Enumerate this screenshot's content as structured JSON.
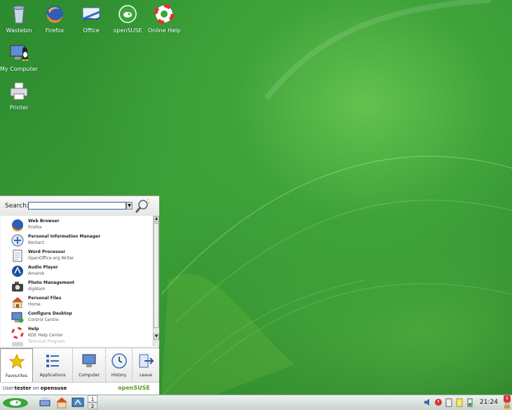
{
  "desktop": {
    "icons": [
      {
        "label": "Wastebin",
        "icon": "wastebin-icon"
      },
      {
        "label": "Firefox",
        "icon": "firefox-icon"
      },
      {
        "label": "Office",
        "icon": "office-icon"
      },
      {
        "label": "openSUSE",
        "icon": "opensuse-icon"
      },
      {
        "label": "Online Help",
        "icon": "help-lifebuoy-icon"
      },
      {
        "label": "My Computer",
        "icon": "computer-icon"
      },
      {
        "label": "Printer",
        "icon": "printer-icon"
      }
    ]
  },
  "menu": {
    "search_label": "Search:",
    "search_value": "",
    "favourites": [
      {
        "title": "Web Browser",
        "subtitle": "Firefox",
        "icon": "firefox-icon"
      },
      {
        "title": "Personal Information Manager",
        "subtitle": "Kontact",
        "icon": "kontact-icon"
      },
      {
        "title": "Word Processor",
        "subtitle": "OpenOffice.org Writer",
        "icon": "writer-icon"
      },
      {
        "title": "Audio Player",
        "subtitle": "Amarok",
        "icon": "amarok-icon"
      },
      {
        "title": "Photo Management",
        "subtitle": "digiKam",
        "icon": "camera-icon"
      },
      {
        "title": "Personal Files",
        "subtitle": "Home",
        "icon": "home-icon"
      },
      {
        "title": "Configure Desktop",
        "subtitle": "Control Centre",
        "icon": "control-centre-icon"
      },
      {
        "title": "Help",
        "subtitle": "KDE Help Center",
        "icon": "help-lifebuoy-icon"
      },
      {
        "title": "Terminal Program",
        "subtitle": "",
        "icon": "terminal-icon"
      }
    ],
    "tabs": [
      {
        "label": "Favourites",
        "icon": "star-icon"
      },
      {
        "label": "Applications",
        "icon": "applications-icon"
      },
      {
        "label": "Computer",
        "icon": "computer-icon"
      },
      {
        "label": "History",
        "icon": "clock-icon"
      },
      {
        "label": "Leave",
        "icon": "leave-icon"
      }
    ],
    "status_user_prefix": "User",
    "status_user": "tester",
    "status_on": "on",
    "status_host": "opensuse",
    "status_logo": "openSUSE"
  },
  "taskbar": {
    "pager": [
      "1",
      "2"
    ],
    "clock": "21:24"
  },
  "colors": {
    "accent": "#3fa33a",
    "search_border": "#3b5fa0"
  }
}
